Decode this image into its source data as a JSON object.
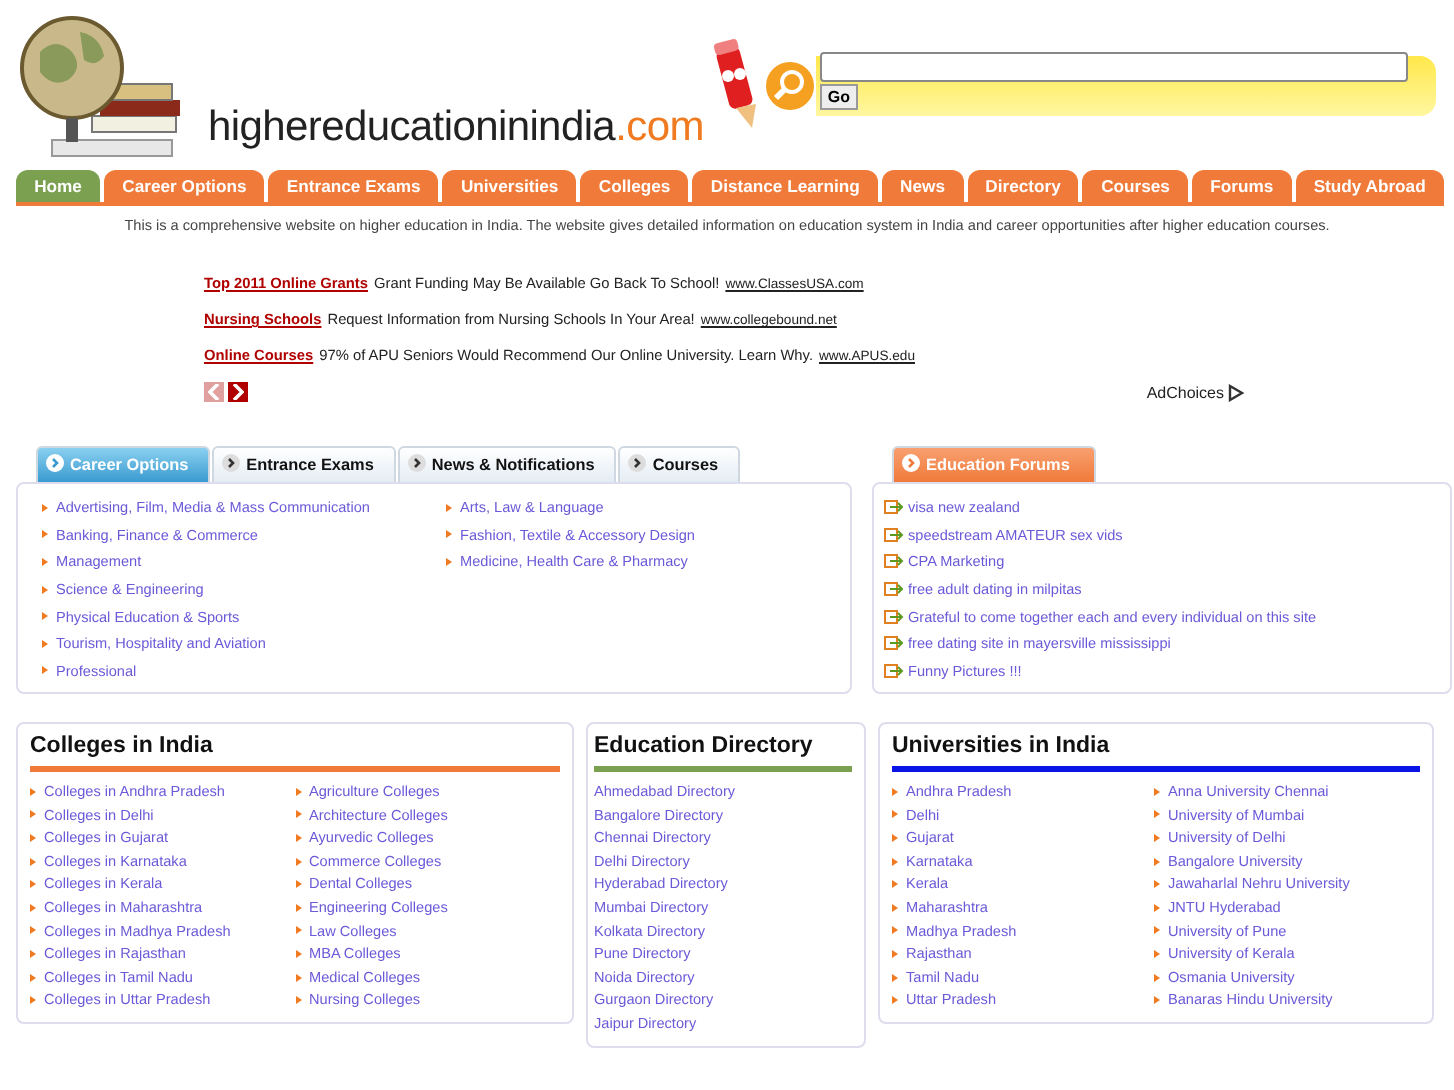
{
  "header": {
    "logo_name": "highereducationinindia",
    "logo_suffix": ".com",
    "search": {
      "button": "Go"
    }
  },
  "nav": [
    {
      "label": "Home",
      "selected": true
    },
    {
      "label": "Career Options",
      "selected": false
    },
    {
      "label": "Entrance Exams",
      "selected": false
    },
    {
      "label": "Universities",
      "selected": false
    },
    {
      "label": "Colleges",
      "selected": false
    },
    {
      "label": "Distance Learning",
      "selected": false
    },
    {
      "label": "News",
      "selected": false
    },
    {
      "label": "Directory",
      "selected": false
    },
    {
      "label": "Courses",
      "selected": false
    },
    {
      "label": "Forums",
      "selected": false
    },
    {
      "label": "Study Abroad",
      "selected": false
    }
  ],
  "tagline": "This is a comprehensive website on higher education in India. The website gives detailed information on education system in India and career opportunities after higher education courses.",
  "ads": [
    {
      "title": "Top 2011 Online Grants",
      "text": "Grant Funding May Be Available Go Back To School!",
      "url": "www.ClassesUSA.com"
    },
    {
      "title": "Nursing Schools",
      "text": "Request Information from Nursing Schools In Your Area!",
      "url": "www.collegebound.net"
    },
    {
      "title": "Online Courses",
      "text": "97% of APU Seniors Would Recommend Our Online University. Learn Why.",
      "url": "www.APUS.edu"
    }
  ],
  "ad_nav": [
    {
      "disabled": true
    },
    {
      "disabled": false
    }
  ],
  "adchoices": "AdChoices",
  "tabs": [
    {
      "label": "Career Options",
      "selected": true
    },
    {
      "label": "Entrance Exams",
      "selected": false
    },
    {
      "label": "News & Notifications",
      "selected": false
    },
    {
      "label": "Courses",
      "selected": false
    }
  ],
  "career_options": {
    "columns": [
      [
        "Advertising, Film, Media & Mass Communication",
        "Banking, Finance & Commerce",
        "Management",
        "Science & Engineering",
        "Physical Education & Sports",
        "Tourism, Hospitality and Aviation",
        "Professional"
      ],
      [
        "Arts, Law & Language",
        "Fashion, Textile & Accessory Design",
        "Medicine, Health Care & Pharmacy"
      ]
    ]
  },
  "forums": {
    "title": "Education Forums",
    "items": [
      "visa new zealand",
      "speedstream AMATEUR sex vids",
      "CPA Marketing",
      "free adult dating in milpitas",
      "Grateful to come together each and every individual on this site",
      "free dating site in mayersville mississippi",
      "Funny Pictures !!!"
    ]
  },
  "colleges": {
    "title": "Colleges in India",
    "color": "#f07a3a",
    "columns": [
      [
        "Colleges in Andhra Pradesh",
        "Colleges in Delhi",
        "Colleges in Gujarat",
        "Colleges in Karnataka",
        "Colleges in Kerala",
        "Colleges in Maharashtra",
        "Colleges in Madhya Pradesh",
        "Colleges in Rajasthan",
        "Colleges in Tamil Nadu",
        "Colleges in Uttar Pradesh"
      ],
      [
        "Agriculture Colleges",
        "Architecture Colleges",
        "Ayurvedic Colleges",
        "Commerce Colleges",
        "Dental Colleges",
        "Engineering Colleges",
        "Law Colleges",
        "MBA Colleges",
        "Medical Colleges",
        "Nursing Colleges"
      ]
    ]
  },
  "directory": {
    "title": "Education Directory",
    "color": "#7aa050",
    "columns": [
      [
        "Ahmedabad Directory",
        "Bangalore Directory",
        "Chennai Directory",
        "Delhi Directory",
        "Hyderabad Directory",
        "Mumbai Directory",
        "Kolkata Directory",
        "Pune Directory",
        "Noida Directory",
        "Gurgaon Directory",
        "Jaipur Directory"
      ]
    ]
  },
  "universities": {
    "title": "Universities in India",
    "color": "#0a14e6",
    "columns": [
      [
        "Andhra Pradesh",
        "Delhi",
        "Gujarat",
        "Karnataka",
        "Kerala",
        "Maharashtra",
        "Madhya Pradesh",
        "Rajasthan",
        "Tamil Nadu",
        "Uttar Pradesh"
      ],
      [
        "Anna University Chennai",
        "University of Mumbai",
        "University of Delhi",
        "Bangalore University",
        "Jawaharlal Nehru University",
        "JNTU Hyderabad",
        "University of Pune",
        "University of Kerala",
        "Osmania University",
        "Banaras Hindu University"
      ]
    ]
  }
}
